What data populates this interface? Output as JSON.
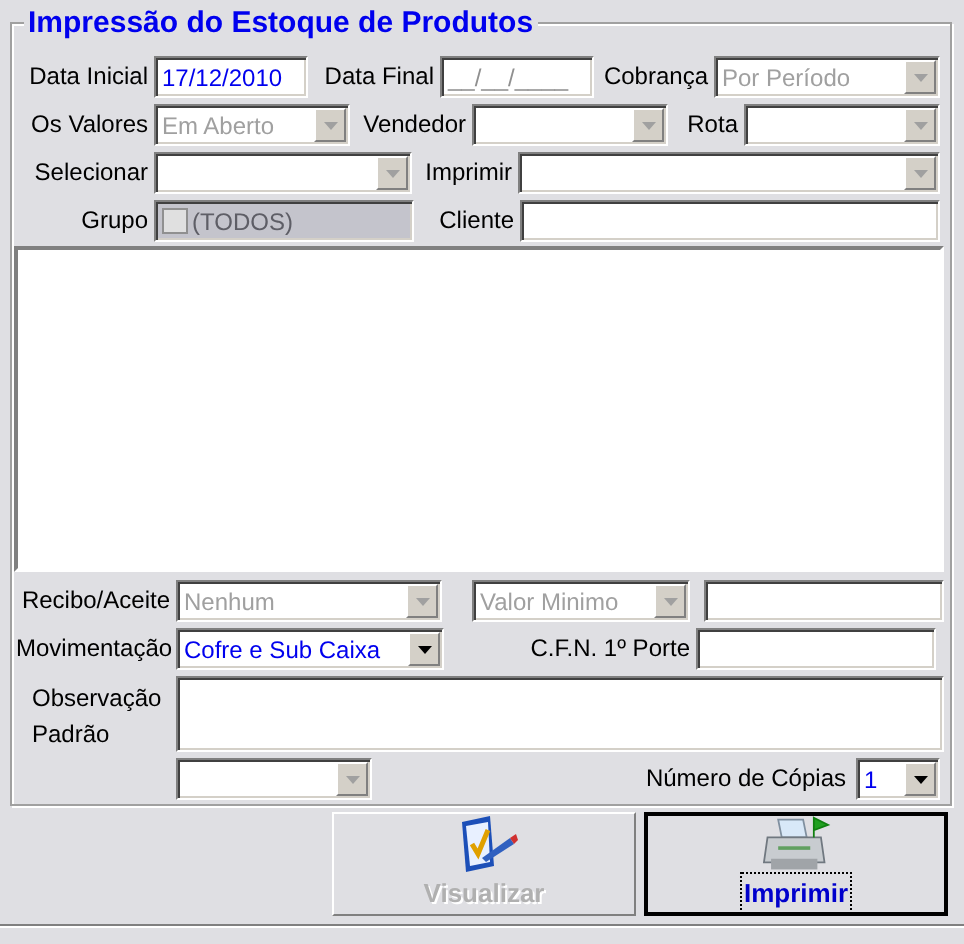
{
  "form_title": "Impressão do Estoque de Produtos",
  "rows": [
    [
      {
        "kind": "label",
        "text": "Data Inicial"
      },
      {
        "kind": "input",
        "value": "17/12/2010"
      },
      {
        "kind": "label",
        "text": "Data Final"
      },
      {
        "kind": "input",
        "placeholder": "__/__/____"
      },
      {
        "kind": "label",
        "text": "Cobrança"
      },
      {
        "kind": "select",
        "value": "Por Período",
        "disabled": true
      }
    ],
    [
      {
        "kind": "label",
        "text": "Os Valores"
      },
      {
        "kind": "select",
        "value": "Em Aberto",
        "disabled": true
      },
      {
        "kind": "label",
        "text": "Vendedor"
      },
      {
        "kind": "select",
        "disabled": true
      },
      {
        "kind": "label",
        "text": "Rota"
      },
      {
        "kind": "select",
        "disabled": true
      }
    ],
    [
      {
        "kind": "label",
        "text": "Selecionar"
      },
      {
        "kind": "select",
        "disabled": true
      },
      {
        "kind": "label",
        "text": "Imprimir"
      },
      {
        "kind": "select",
        "disabled": true
      }
    ],
    [
      {
        "kind": "label",
        "text": "Grupo"
      },
      {
        "kind": "checkfield",
        "value": "(TODOS)",
        "checked": false,
        "disabled": true
      },
      {
        "kind": "label",
        "text": "Cliente"
      },
      {
        "kind": "input"
      }
    ],
    [
      {
        "kind": "listbox"
      }
    ],
    [
      {
        "kind": "label",
        "text": "Recibo/Aceite"
      },
      {
        "kind": "select",
        "value": "Nenhum",
        "disabled": true
      },
      {
        "kind": "select",
        "value": "Valor Minimo",
        "disabled": true
      },
      {
        "kind": "input"
      }
    ],
    [
      {
        "kind": "label",
        "text": "Movimentação"
      },
      {
        "kind": "select",
        "value": "Cofre e Sub Caixa",
        "disabled": false
      },
      {
        "kind": "label",
        "text": "C.F.N. 1º Porte"
      },
      {
        "kind": "input"
      }
    ],
    [
      {
        "kind": "label",
        "text": "Observação Padrão"
      },
      {
        "kind": "textarea"
      }
    ],
    [
      {
        "kind": "select",
        "disabled": true
      },
      {
        "kind": "label",
        "text": "Número de Cópias"
      },
      {
        "kind": "select",
        "value": "1",
        "disabled": false
      }
    ]
  ],
  "buttons": [
    {
      "kind": "preview",
      "label": "Visualizar",
      "disabled": true,
      "focused": false
    },
    {
      "kind": "printer",
      "label": "Imprimir",
      "disabled": false,
      "focused": true
    }
  ]
}
